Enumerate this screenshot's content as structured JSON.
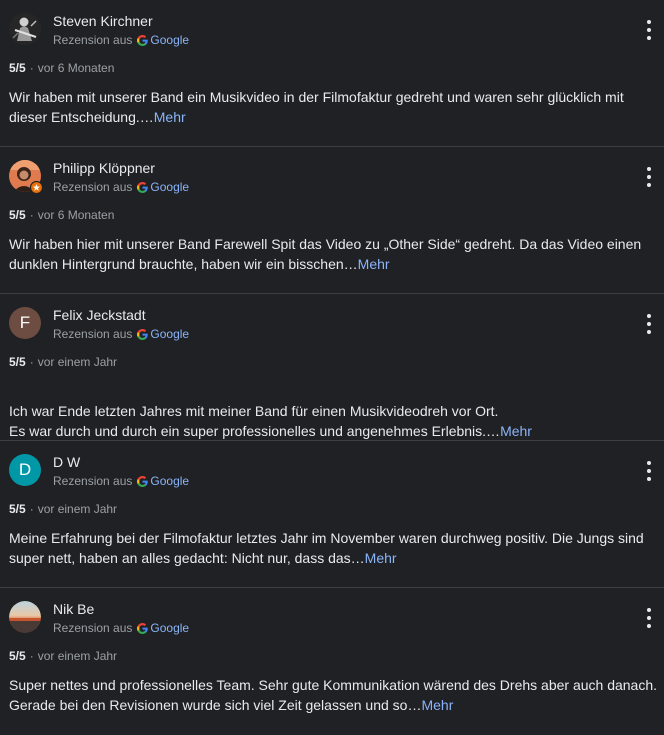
{
  "reviews": [
    {
      "name": "Steven Kirchner",
      "avatar": {
        "type": "photo",
        "icon": "guitarist-photo",
        "letter": ""
      },
      "source_prefix": "Rezension aus",
      "source_name": "Google",
      "rating": "5/5",
      "time": "vor 6 Monaten",
      "text": "Wir haben mit unserer Band ein Musikvideo in der Filmofaktur gedreht und waren sehr glücklich mit dieser Entscheidung.…",
      "more": "Mehr"
    },
    {
      "name": "Philipp Klöppner",
      "avatar": {
        "type": "photo",
        "icon": "person-photo-local-guide",
        "letter": ""
      },
      "source_prefix": "Rezension aus",
      "source_name": "Google",
      "rating": "5/5",
      "time": "vor 6 Monaten",
      "text": "Wir haben hier mit unserer Band Farewell Spit das Video zu „Other Side“ gedreht. Da das Video einen dunklen Hintergrund brauchte, haben wir ein bisschen…",
      "more": "Mehr"
    },
    {
      "name": "Felix Jeckstadt",
      "avatar": {
        "type": "letter",
        "icon": "",
        "letter": "F",
        "color": "#6d4c41"
      },
      "source_prefix": "Rezension aus",
      "source_name": "Google",
      "rating": "5/5",
      "time": "vor einem Jahr",
      "text": "Ich war Ende letzten Jahres mit meiner Band für einen Musikvideodreh vor Ort.\nEs war durch und durch ein super professionelles und angenehmes Erlebnis.…",
      "more": "Mehr"
    },
    {
      "name": "D W",
      "avatar": {
        "type": "letter",
        "icon": "",
        "letter": "D",
        "color": "#0097a7"
      },
      "source_prefix": "Rezension aus",
      "source_name": "Google",
      "rating": "5/5",
      "time": "vor einem Jahr",
      "text": "Meine Erfahrung bei der Filmofaktur letztes Jahr im November waren durchweg positiv. Die Jungs sind super nett, haben an alles gedacht: Nicht nur, dass das…",
      "more": "Mehr"
    },
    {
      "name": "Nik Be",
      "avatar": {
        "type": "photo",
        "icon": "sunset-landscape-photo",
        "letter": ""
      },
      "source_prefix": "Rezension aus",
      "source_name": "Google",
      "rating": "5/5",
      "time": "vor einem Jahr",
      "text": "Super nettes und professionelles Team. Sehr gute Kommunikation wärend des Drehs aber auch danach. Gerade bei den Revisionen wurde sich viel Zeit gelassen und so…",
      "more": "Mehr"
    }
  ],
  "colors": {
    "background": "#202124",
    "text": "#e8eaed",
    "secondary": "#9aa0a6",
    "link": "#8ab4f8",
    "divider": "#3c4043"
  }
}
